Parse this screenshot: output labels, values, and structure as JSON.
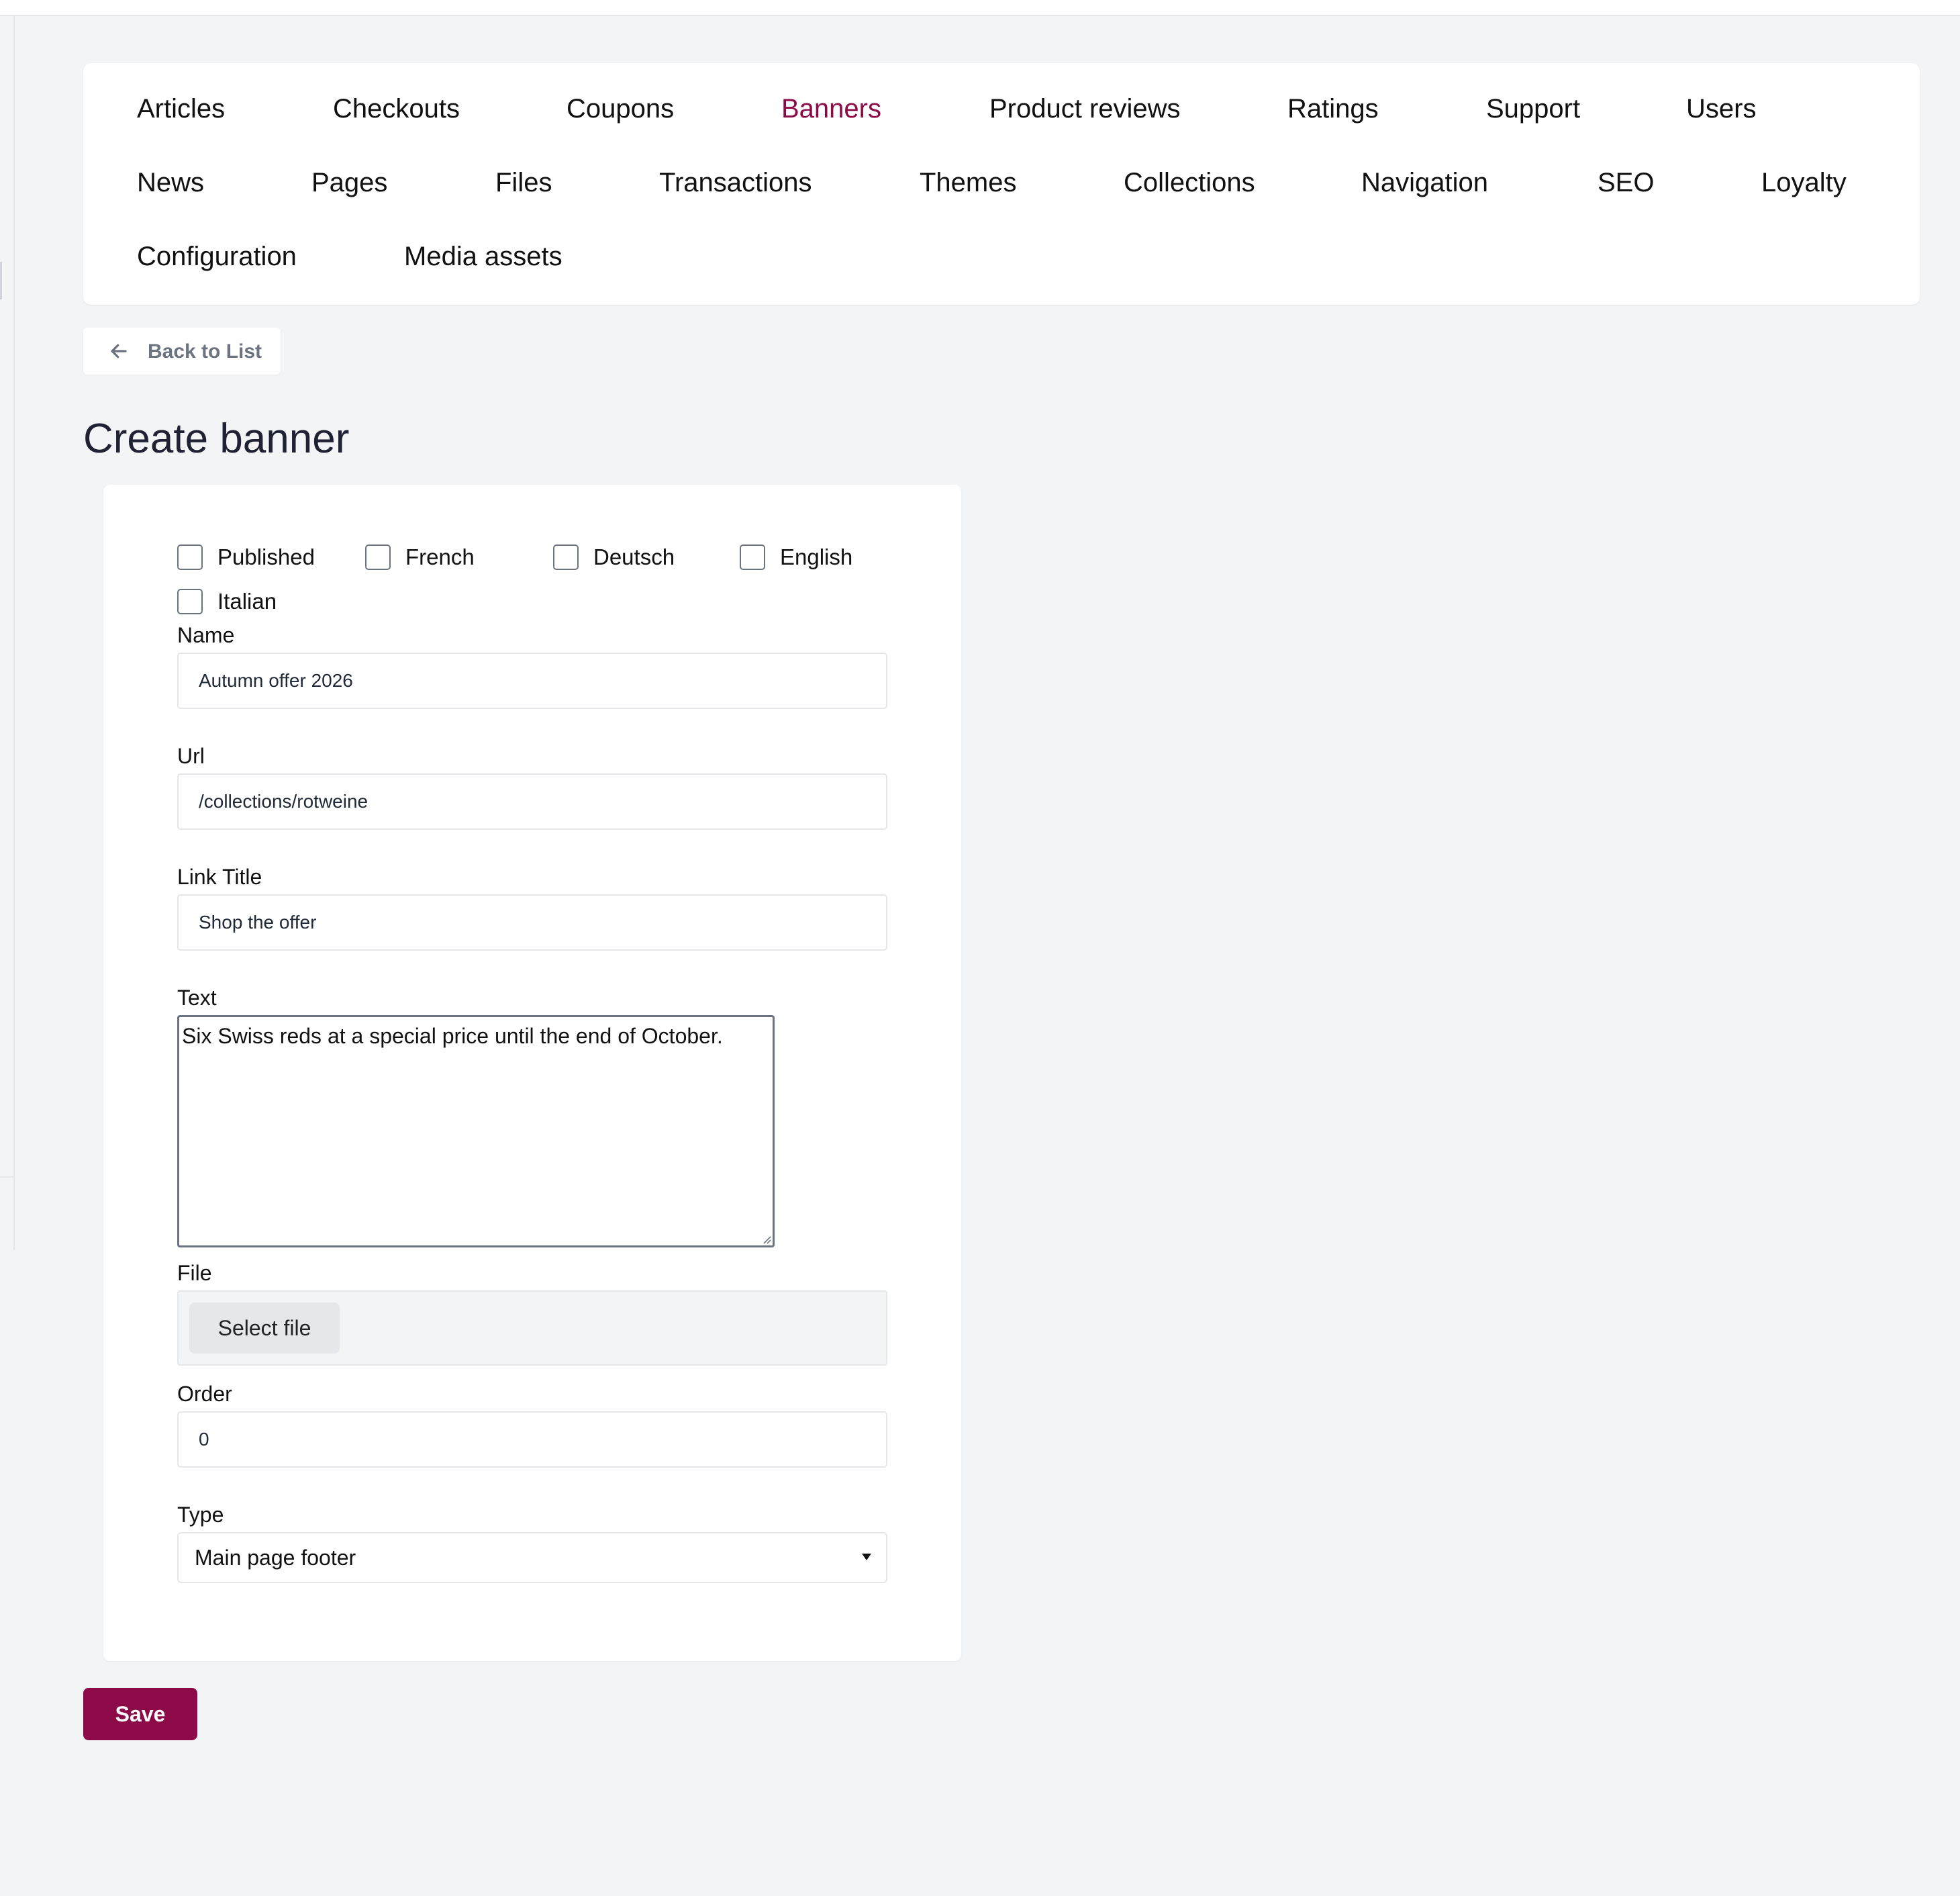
{
  "colors": {
    "accent": "#8b0a47",
    "background": "#f3f4f6"
  },
  "tabs": {
    "active": "Banners",
    "items": [
      {
        "label": "Articles"
      },
      {
        "label": "Checkouts"
      },
      {
        "label": "Coupons"
      },
      {
        "label": "Banners"
      },
      {
        "label": "Product reviews"
      },
      {
        "label": "Ratings"
      },
      {
        "label": "Support"
      },
      {
        "label": "Users"
      },
      {
        "label": "News"
      },
      {
        "label": "Pages"
      },
      {
        "label": "Files"
      },
      {
        "label": "Transactions"
      },
      {
        "label": "Themes"
      },
      {
        "label": "Collections"
      },
      {
        "label": "Navigation"
      },
      {
        "label": "SEO"
      },
      {
        "label": "Loyalty"
      },
      {
        "label": "Configuration"
      },
      {
        "label": "Media assets"
      }
    ]
  },
  "back_button": {
    "icon": "arrow-left-icon",
    "label": "Back to List"
  },
  "page_title": "Create banner",
  "form": {
    "checkboxes": [
      {
        "label": "Published",
        "checked": false
      },
      {
        "label": "French",
        "checked": false
      },
      {
        "label": "Deutsch",
        "checked": false
      },
      {
        "label": "English",
        "checked": false
      },
      {
        "label": "Italian",
        "checked": false
      }
    ],
    "name": {
      "label": "Name",
      "value": "Autumn offer 2026"
    },
    "url": {
      "label": "Url",
      "value": "/collections/rotweine"
    },
    "link_title": {
      "label": "Link Title",
      "value": "Shop the offer"
    },
    "text": {
      "label": "Text",
      "value": "Six Swiss reds at a special price until the end of October."
    },
    "file": {
      "label": "File",
      "button": "Select file"
    },
    "order": {
      "label": "Order",
      "value": "0"
    },
    "type": {
      "label": "Type",
      "selected": "Main page footer"
    }
  },
  "save_button": {
    "label": "Save"
  }
}
